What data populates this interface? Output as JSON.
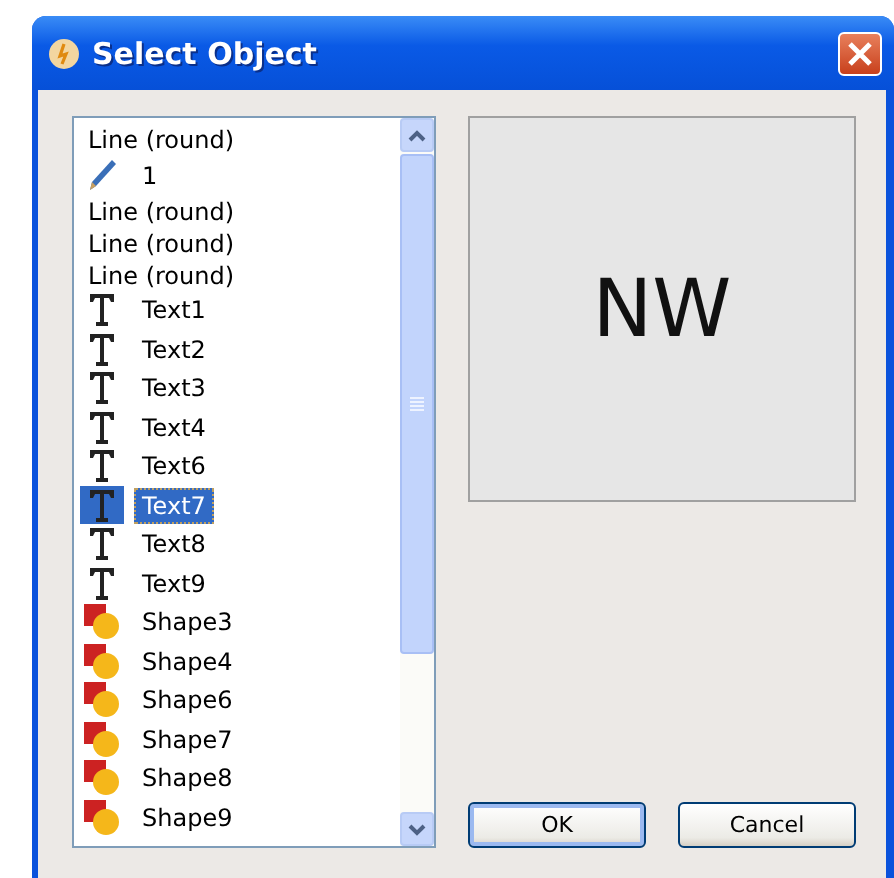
{
  "window": {
    "title": "Select Object"
  },
  "objects": [
    {
      "kind": "line",
      "label": "Line (round)",
      "selected": false
    },
    {
      "kind": "pen",
      "label": "1",
      "selected": false
    },
    {
      "kind": "line",
      "label": "Line (round)",
      "selected": false
    },
    {
      "kind": "line",
      "label": "Line (round)",
      "selected": false
    },
    {
      "kind": "line",
      "label": "Line (round)",
      "selected": false
    },
    {
      "kind": "text",
      "label": "Text1",
      "selected": false
    },
    {
      "kind": "text",
      "label": "Text2",
      "selected": false
    },
    {
      "kind": "text",
      "label": "Text3",
      "selected": false
    },
    {
      "kind": "text",
      "label": "Text4",
      "selected": false
    },
    {
      "kind": "text",
      "label": "Text6",
      "selected": false
    },
    {
      "kind": "text",
      "label": "Text7",
      "selected": true
    },
    {
      "kind": "text",
      "label": "Text8",
      "selected": false
    },
    {
      "kind": "text",
      "label": "Text9",
      "selected": false
    },
    {
      "kind": "shape",
      "label": "Shape3",
      "selected": false
    },
    {
      "kind": "shape",
      "label": "Shape4",
      "selected": false
    },
    {
      "kind": "shape",
      "label": "Shape6",
      "selected": false
    },
    {
      "kind": "shape",
      "label": "Shape7",
      "selected": false
    },
    {
      "kind": "shape",
      "label": "Shape8",
      "selected": false
    },
    {
      "kind": "shape",
      "label": "Shape9",
      "selected": false
    }
  ],
  "preview": {
    "text": "NW"
  },
  "buttons": [
    "OK",
    "Cancel"
  ]
}
